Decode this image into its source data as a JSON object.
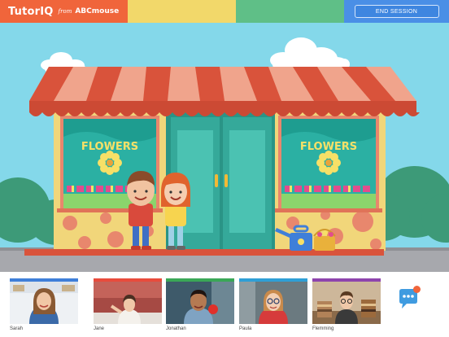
{
  "app": {
    "brand": {
      "name": "TutorIQ",
      "from": "from",
      "partner": "ABCmouse"
    },
    "end_session_label": "END SESSION"
  },
  "scene": {
    "sign_left": "FLOWERS",
    "sign_right": "FLOWERS"
  },
  "students": [
    {
      "name": "Sarah",
      "accent": "#3f7fd9"
    },
    {
      "name": "Jane",
      "accent": "#e84b3c"
    },
    {
      "name": "Jonathan",
      "accent": "#3aa757"
    },
    {
      "name": "Paula",
      "accent": "#2f9fd6"
    },
    {
      "name": "Flemming",
      "accent": "#8e44ad"
    }
  ],
  "colors": {
    "brand_orange": "#f0653b",
    "seg_yellow": "#f2d86a",
    "seg_green": "#5fbf87",
    "seg_blue": "#4a8fe6",
    "sky": "#84d8ea",
    "shop_wall": "#f1d67a",
    "awning_red": "#d9533b",
    "door_teal": "#35a99a"
  },
  "icons": [
    "chat-icon",
    "notification-dot"
  ]
}
